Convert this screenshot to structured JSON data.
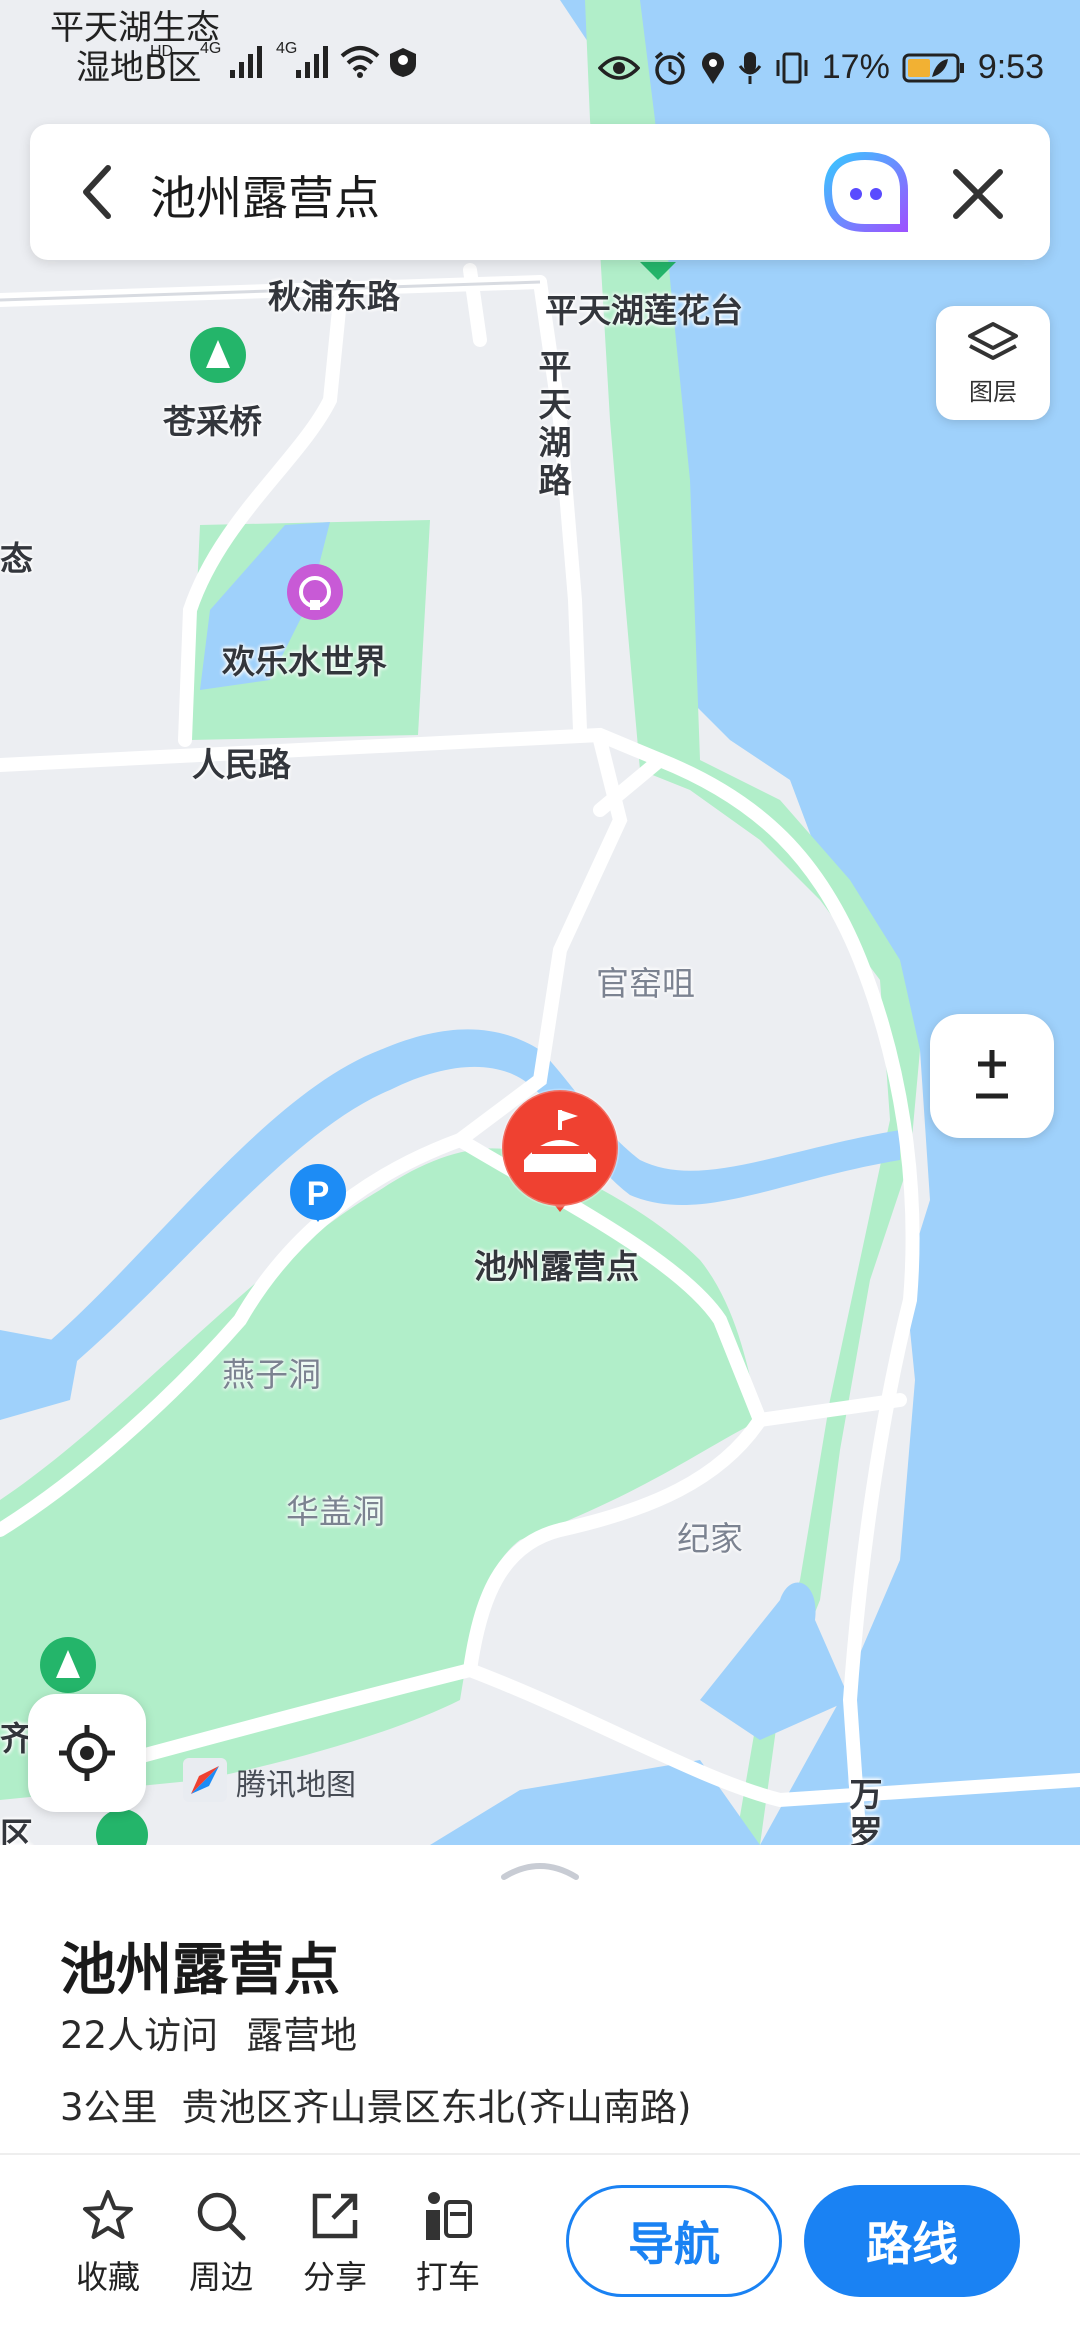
{
  "status_bar": {
    "location_label_line1": "平天湖生态",
    "location_label_line2": "湿地B区",
    "network_1": "4G",
    "network_2": "4G",
    "hd_1": "HD",
    "hd_2": "HD",
    "battery": "17%",
    "time": "9:53"
  },
  "search": {
    "query": "池州露营点",
    "back_icon": "chevron-left-icon",
    "assistant_icon": "ai-assistant-icon",
    "close_icon": "close-icon"
  },
  "map": {
    "labels": {
      "qiupu_road": "秋浦东路",
      "pingtianhu_lotus": "平天湖莲花台",
      "pingtianhu_road": "平天湖路",
      "cangcaiqiao": "苍采桥",
      "huanle_water": "欢乐水世界",
      "renmin_road": "人民路",
      "guanyaoju": "官窑咀",
      "poi_name": "池州露营点",
      "yanzi_cave": "燕子洞",
      "huagai_cave": "华盖洞",
      "jijia": "纪家",
      "wan_luo": "万罗",
      "qishan_area": "齐山景区",
      "area_edge": "区",
      "left_edge": "态"
    },
    "layers_label": "图层",
    "zoom_label": "±",
    "watermark": "腾讯地图",
    "colors": {
      "land": "#eceef2",
      "water": "#9fd1fb",
      "park": "#b1eec9",
      "road": "#ffffff",
      "poi_red": "#ef4131",
      "parking_blue": "#1d8cf5"
    }
  },
  "place": {
    "name": "池州露营点",
    "visitors": "22人访问",
    "category": "露营地",
    "distance": "3公里",
    "address": "贵池区齐山景区东北(齐山南路)"
  },
  "actions": [
    {
      "label": "收藏",
      "icon": "star-icon"
    },
    {
      "label": "周边",
      "icon": "search-icon"
    },
    {
      "label": "分享",
      "icon": "share-icon"
    },
    {
      "label": "打车",
      "icon": "taxi-icon"
    }
  ],
  "buttons": {
    "navigate": "导航",
    "route": "路线"
  },
  "accent_color": "#1a82f3"
}
